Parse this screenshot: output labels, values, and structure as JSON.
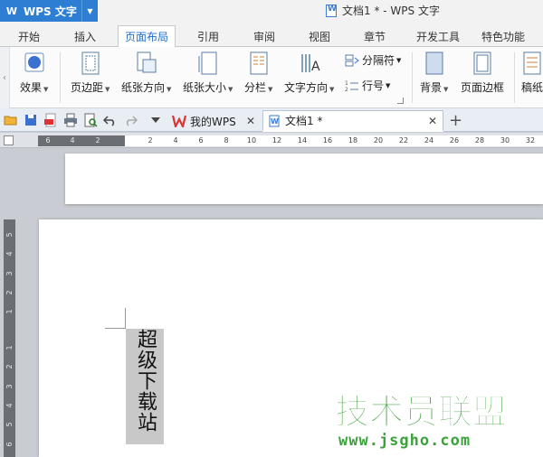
{
  "app": {
    "name": "WPS 文字",
    "window_title": "文档1 * - WPS 文字"
  },
  "menu_tabs": [
    {
      "label": "开始"
    },
    {
      "label": "插入"
    },
    {
      "label": "页面布局",
      "active": true
    },
    {
      "label": "引用"
    },
    {
      "label": "审阅"
    },
    {
      "label": "视图"
    },
    {
      "label": "章节"
    },
    {
      "label": "开发工具"
    },
    {
      "label": "特色功能"
    }
  ],
  "ribbon": {
    "effects": "效果",
    "margins": "页边距",
    "orientation": "纸张方向",
    "size": "纸张大小",
    "columns": "分栏",
    "text_direction": "文字方向",
    "breaks": "分隔符",
    "line_numbers": "行号",
    "background": "背景",
    "page_border": "页面边框",
    "cutoff": "稿纸"
  },
  "doc_tabs": [
    {
      "label": "我的WPS"
    },
    {
      "label": "文档1 *",
      "active": true
    }
  ],
  "ruler": {
    "h_numbers": [
      "6",
      "4",
      "2",
      "2",
      "4",
      "6",
      "8",
      "10",
      "12",
      "14",
      "16",
      "18",
      "20",
      "22",
      "24",
      "26",
      "28",
      "30",
      "32"
    ],
    "v_numbers": [
      "5",
      "4",
      "3",
      "2",
      "1",
      "1",
      "2",
      "3",
      "4",
      "5",
      "6"
    ]
  },
  "document": {
    "vertical_text": "超级下载站"
  },
  "watermark": {
    "title": "技术员联盟",
    "url": "www.jsgho.com"
  },
  "colors": {
    "accent": "#2e7fd3",
    "watermark_green": "#3da23d",
    "selection_gray": "#c8c8c8"
  }
}
